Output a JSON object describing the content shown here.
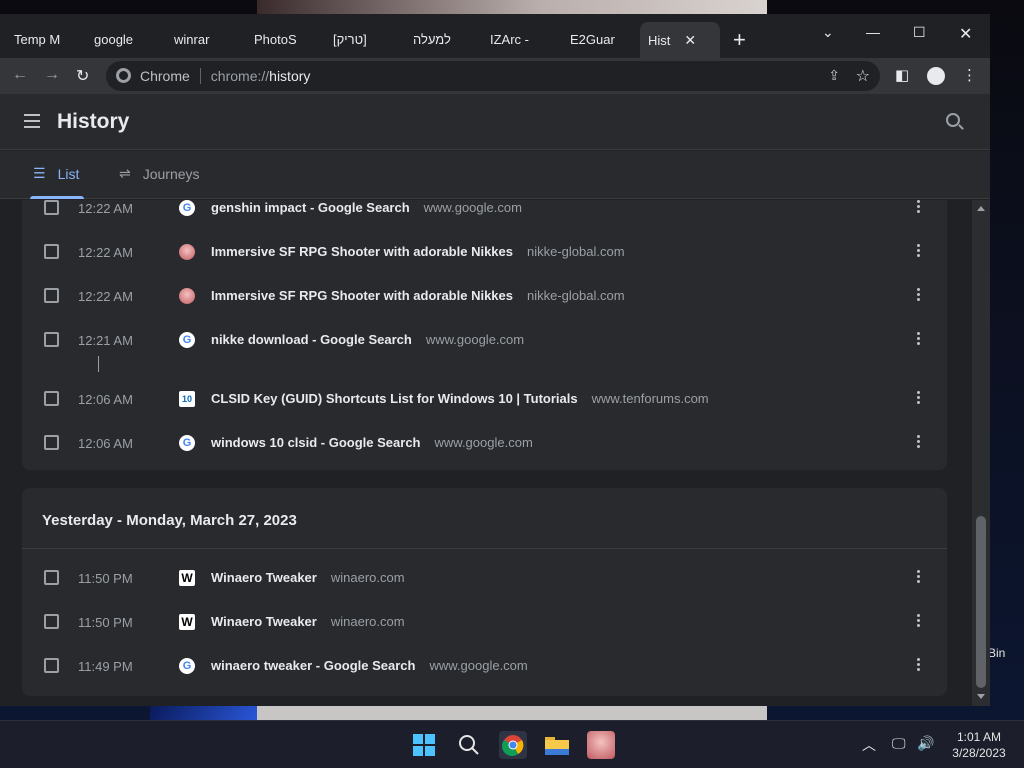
{
  "browser": {
    "tabs": [
      {
        "label": "Temp M",
        "icon": "temp-mail-icon"
      },
      {
        "label": "google",
        "icon": "google-icon"
      },
      {
        "label": "winrar",
        "icon": "google-icon"
      },
      {
        "label": "PhotoS",
        "icon": "photoshop-icon"
      },
      {
        "label": "[טריק]",
        "icon": "snowflake-icon"
      },
      {
        "label": "למעלה",
        "icon": "stripe-icon"
      },
      {
        "label": "IZArc -",
        "icon": "izarc-icon"
      },
      {
        "label": "E2Guar",
        "icon": "globe-icon"
      },
      {
        "label": "Hist",
        "icon": "history-icon",
        "active": true
      }
    ],
    "new_tab": "+",
    "omnibox": {
      "chip": "Chrome",
      "url_scheme": "chrome://",
      "url_path": "history"
    }
  },
  "history": {
    "title": "History",
    "tabs": {
      "list": "List",
      "journeys": "Journeys"
    },
    "today_entries": [
      {
        "time": "12:22 AM",
        "title": "genshin impact - Google Search",
        "domain": "www.google.com",
        "icon": "google"
      },
      {
        "time": "12:22 AM",
        "title": "Immersive SF RPG Shooter with adorable Nikkes",
        "domain": "nikke-global.com",
        "icon": "nikke"
      },
      {
        "time": "12:22 AM",
        "title": "Immersive SF RPG Shooter with adorable Nikkes",
        "domain": "nikke-global.com",
        "icon": "nikke"
      },
      {
        "time": "12:21 AM",
        "title": "nikke download - Google Search",
        "domain": "www.google.com",
        "icon": "google"
      },
      {
        "time": "12:06 AM",
        "title": "CLSID Key (GUID) Shortcuts List for Windows 10 | Tutorials",
        "domain": "www.tenforums.com",
        "icon": "tenforums"
      },
      {
        "time": "12:06 AM",
        "title": "windows 10 clsid - Google Search",
        "domain": "www.google.com",
        "icon": "google"
      }
    ],
    "yesterday": {
      "heading": "Yesterday - Monday, March 27, 2023",
      "entries": [
        {
          "time": "11:50 PM",
          "title": "Winaero Tweaker",
          "domain": "winaero.com",
          "icon": "winaero"
        },
        {
          "time": "11:50 PM",
          "title": "Winaero Tweaker",
          "domain": "winaero.com",
          "icon": "winaero"
        },
        {
          "time": "11:49 PM",
          "title": "winaero tweaker - Google Search",
          "domain": "www.google.com",
          "icon": "google"
        }
      ]
    }
  },
  "desktop": {
    "recycle_label": "Bin"
  },
  "taskbar": {
    "time": "1:01 AM",
    "date": "3/28/2023"
  },
  "colors": {
    "accent": "#8ab4f8",
    "background": "#202124",
    "card": "#292a2d"
  }
}
